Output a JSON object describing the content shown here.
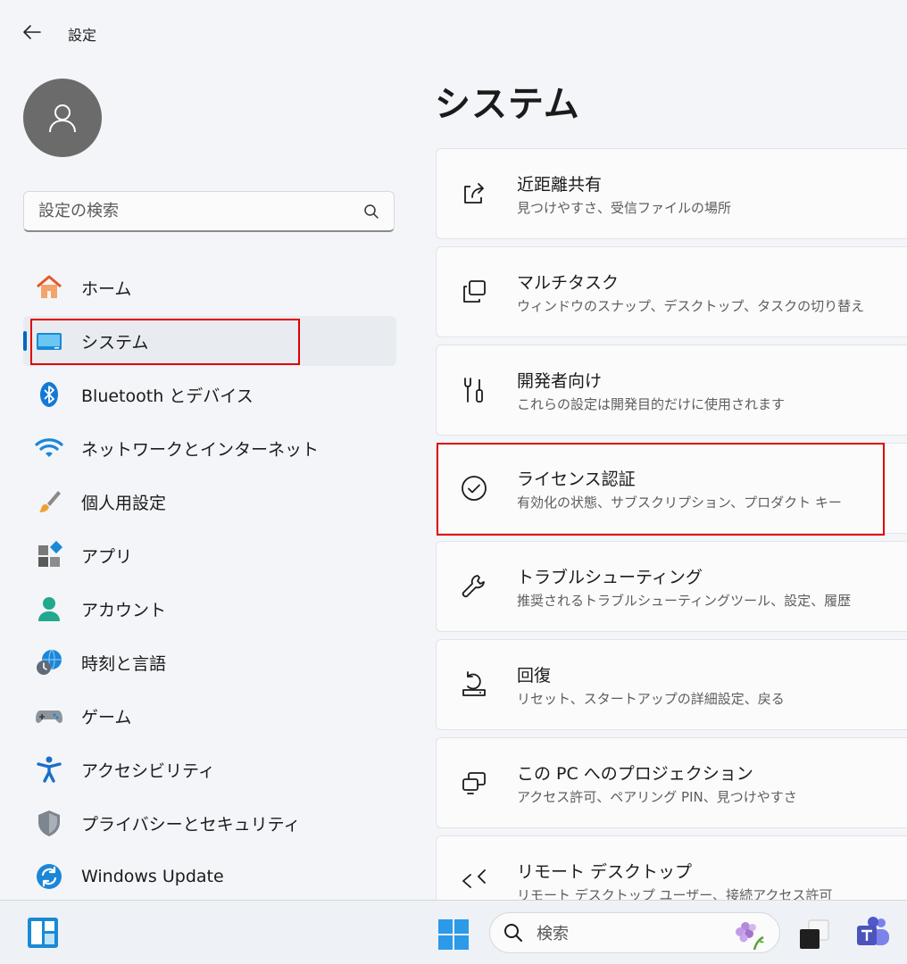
{
  "window": {
    "title": "設定"
  },
  "search": {
    "placeholder": "設定の検索"
  },
  "nav": [
    {
      "label": "ホーム",
      "icon": "home-icon"
    },
    {
      "label": "システム",
      "icon": "system-icon",
      "active": true
    },
    {
      "label": "Bluetooth とデバイス",
      "icon": "bluetooth-icon"
    },
    {
      "label": "ネットワークとインターネット",
      "icon": "wifi-icon"
    },
    {
      "label": "個人用設定",
      "icon": "brush-icon"
    },
    {
      "label": "アプリ",
      "icon": "apps-icon"
    },
    {
      "label": "アカウント",
      "icon": "account-icon"
    },
    {
      "label": "時刻と言語",
      "icon": "time-language-icon"
    },
    {
      "label": "ゲーム",
      "icon": "gamepad-icon"
    },
    {
      "label": "アクセシビリティ",
      "icon": "accessibility-icon"
    },
    {
      "label": "プライバシーとセキュリティ",
      "icon": "shield-icon"
    },
    {
      "label": "Windows Update",
      "icon": "windows-update-icon"
    }
  ],
  "main": {
    "title": "システム",
    "cards": [
      {
        "title": "近距離共有",
        "subtitle": "見つけやすさ、受信ファイルの場所",
        "icon": "share-icon"
      },
      {
        "title": "マルチタスク",
        "subtitle": "ウィンドウのスナップ、デスクトップ、タスクの切り替え",
        "icon": "multitask-icon"
      },
      {
        "title": "開発者向け",
        "subtitle": "これらの設定は開発目的だけに使用されます",
        "icon": "developer-tools-icon"
      },
      {
        "title": "ライセンス認証",
        "subtitle": "有効化の状態、サブスクリプション、プロダクト キー",
        "icon": "check-circle-icon"
      },
      {
        "title": "トラブルシューティング",
        "subtitle": "推奨されるトラブルシューティングツール、設定、履歴",
        "icon": "wrench-icon"
      },
      {
        "title": "回復",
        "subtitle": "リセット、スタートアップの詳細設定、戻る",
        "icon": "recovery-icon"
      },
      {
        "title": "この PC へのプロジェクション",
        "subtitle": "アクセス許可、ペアリング PIN、見つけやすさ",
        "icon": "projection-icon"
      },
      {
        "title": "リモート デスクトップ",
        "subtitle": "リモート デスクトップ ユーザー、接続アクセス許可",
        "icon": "remote-desktop-icon"
      }
    ]
  },
  "taskbar": {
    "search_label": "検索"
  },
  "colors": {
    "accent": "#0067c0",
    "highlight": "#e00000"
  }
}
